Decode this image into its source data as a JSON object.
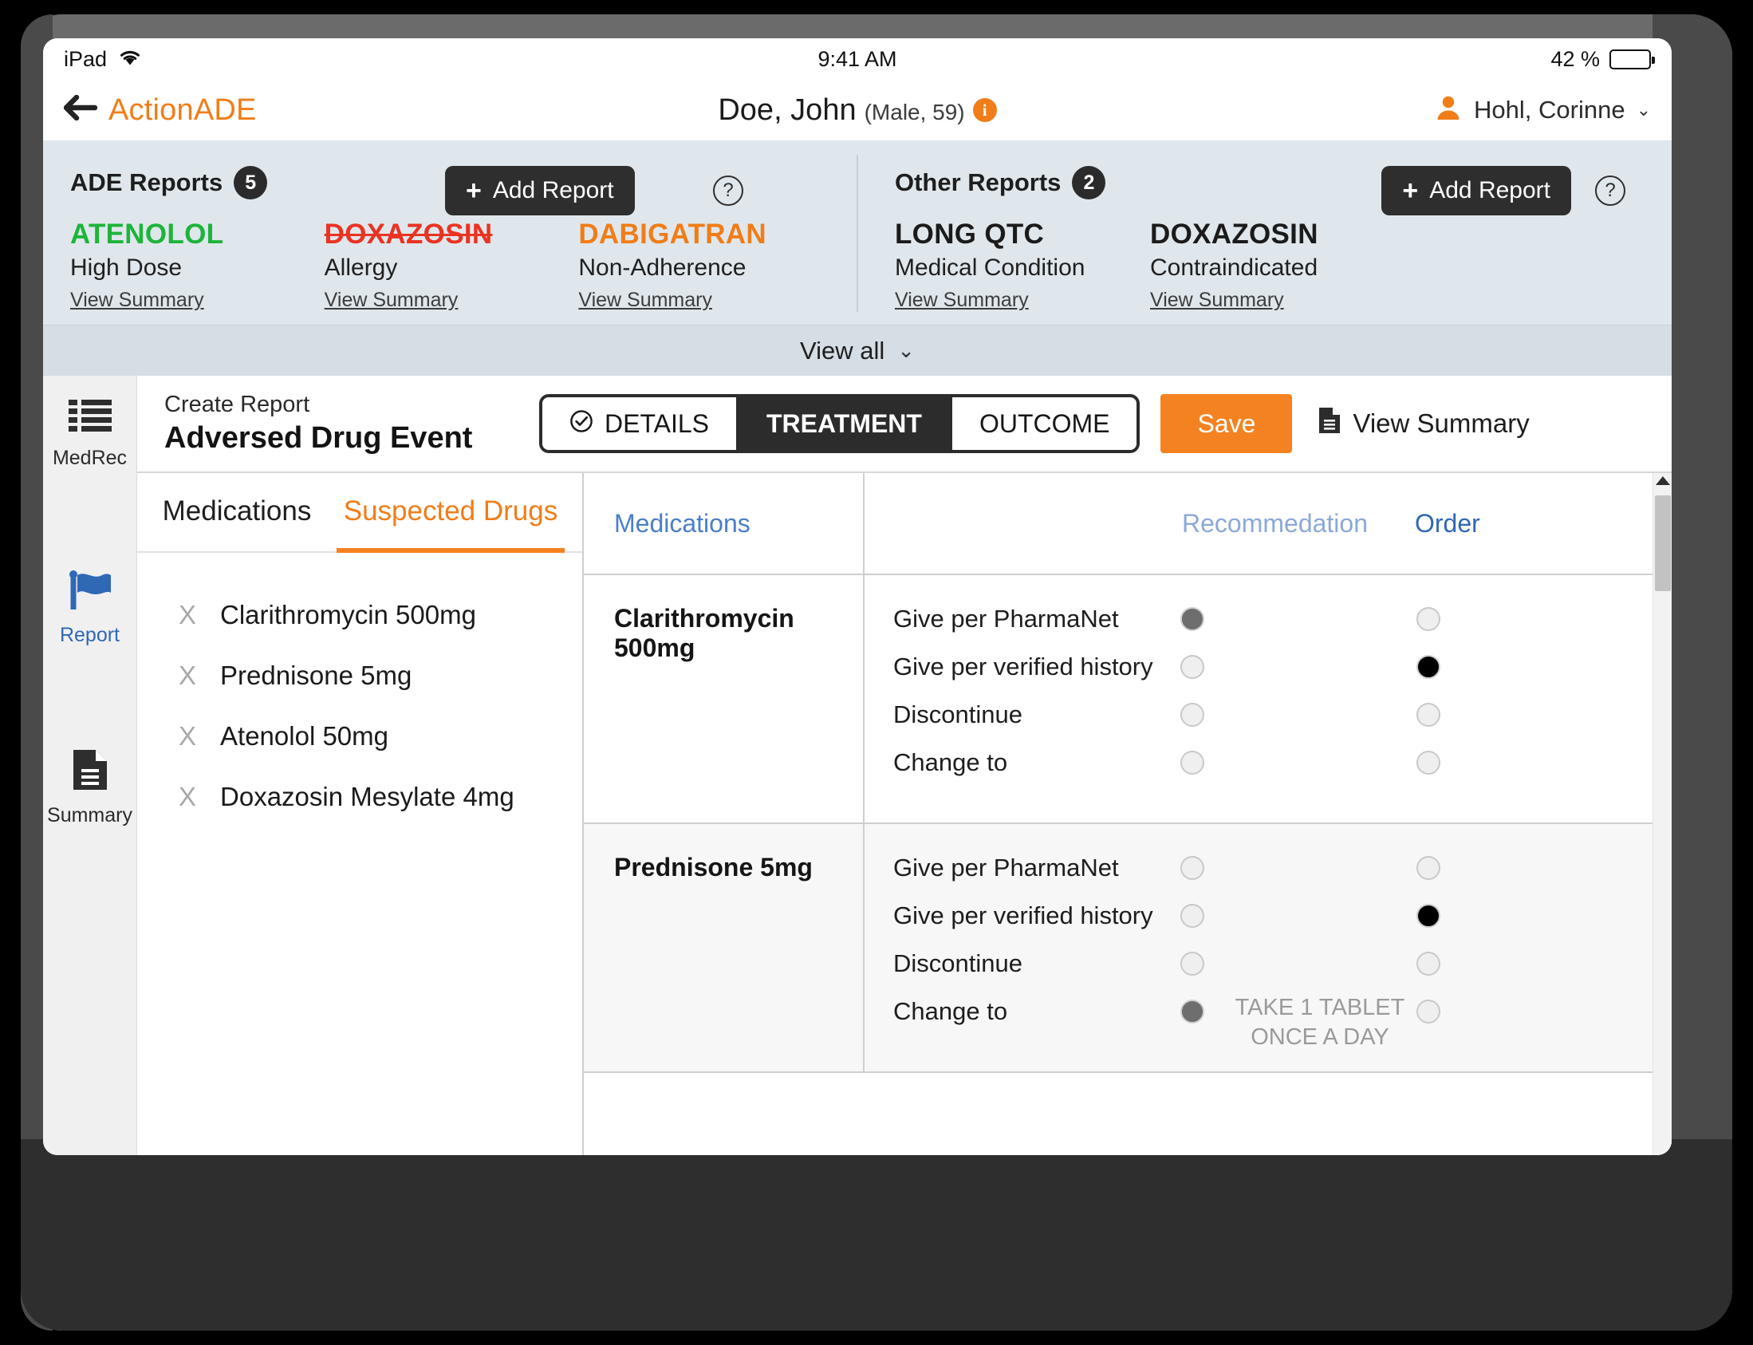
{
  "status_bar": {
    "device": "iPad",
    "wifi_icon": "wifi-icon",
    "time": "9:41 AM",
    "battery_percent": "42 %"
  },
  "nav": {
    "back_icon": "back-arrow-icon",
    "brand": "ActionADE",
    "patient_name": "Doe, John",
    "patient_meta": "(Male, 59)",
    "info_icon": "info-icon",
    "user_name": "Hohl, Corinne",
    "user_icon": "user-avatar-icon",
    "chevron": "⌄"
  },
  "reports": {
    "ade": {
      "title": "ADE Reports",
      "count": "5",
      "add_label": "Add Report",
      "help_glyph": "?",
      "items": [
        {
          "drug": "ATENOLOL",
          "reason": "High Dose",
          "link": "View Summary",
          "style": "green"
        },
        {
          "drug": "DOXAZOSIN",
          "reason": "Allergy",
          "link": "View Summary",
          "style": "red"
        },
        {
          "drug": "DABIGATRAN",
          "reason": "Non-Adherence",
          "link": "View Summary",
          "style": "orange"
        }
      ]
    },
    "other": {
      "title": "Other Reports",
      "count": "2",
      "add_label": "Add Report",
      "help_glyph": "?",
      "items": [
        {
          "drug": "LONG QTC",
          "reason": "Medical Condition",
          "link": "View Summary",
          "style": "dark"
        },
        {
          "drug": "DOXAZOSIN",
          "reason": "Contraindicated",
          "link": "View Summary",
          "style": "dark"
        }
      ]
    },
    "view_all": "View all",
    "view_all_chevron": "⌄"
  },
  "rail": {
    "items": [
      {
        "label": "MedRec",
        "icon": "list-icon",
        "active": false
      },
      {
        "label": "Report",
        "icon": "flag-icon",
        "active": true
      },
      {
        "label": "Summary",
        "icon": "document-icon",
        "active": false
      }
    ]
  },
  "toolbar": {
    "kicker": "Create Report",
    "title": "Adversed Drug Event",
    "segments": [
      {
        "label": "DETAILS",
        "icon": "check-circle-icon",
        "active": false
      },
      {
        "label": "TREATMENT",
        "icon": "",
        "active": true
      },
      {
        "label": "OUTCOME",
        "icon": "",
        "active": false
      }
    ],
    "save_label": "Save",
    "view_summary_label": "View Summary",
    "view_summary_icon": "document-icon"
  },
  "left_panel": {
    "tabs": [
      {
        "label": "Medications",
        "active": false
      },
      {
        "label": "Suspected Drugs",
        "active": true
      }
    ],
    "drugs": [
      {
        "remove_glyph": "X",
        "name": "Clarithromycin 500mg"
      },
      {
        "remove_glyph": "X",
        "name": "Prednisone 5mg"
      },
      {
        "remove_glyph": "X",
        "name": "Atenolol 50mg"
      },
      {
        "remove_glyph": "X",
        "name": "Doxazosin Mesylate 4mg"
      }
    ]
  },
  "treatment_table": {
    "headers": {
      "medications": "Medications",
      "recommendation": "Recommedation",
      "order": "Order"
    },
    "rows": [
      {
        "medication": "Clarithromycin 500mg",
        "shaded": false,
        "options": [
          {
            "label": "Give per PharmaNet",
            "rec": "grey",
            "ord": "empty",
            "extra": ""
          },
          {
            "label": "Give per verified history",
            "rec": "empty",
            "ord": "black",
            "extra": ""
          },
          {
            "label": "Discontinue",
            "rec": "empty",
            "ord": "empty",
            "extra": ""
          },
          {
            "label": "Change to",
            "rec": "empty",
            "ord": "empty",
            "extra": ""
          }
        ]
      },
      {
        "medication": "Prednisone 5mg",
        "shaded": true,
        "options": [
          {
            "label": "Give per PharmaNet",
            "rec": "empty",
            "ord": "empty",
            "extra": ""
          },
          {
            "label": "Give per verified history",
            "rec": "empty",
            "ord": "black",
            "extra": ""
          },
          {
            "label": "Discontinue",
            "rec": "empty",
            "ord": "empty",
            "extra": ""
          },
          {
            "label": "Change to",
            "rec": "grey",
            "ord": "empty",
            "extra": "TAKE 1 TABLET ONCE A DAY"
          }
        ]
      }
    ]
  },
  "colors": {
    "brand_orange": "#f07d18",
    "save_orange": "#f58220",
    "panel_blue": "#dfe7ec",
    "viewall_blue": "#d4dee4",
    "link_blue": "#2f68b5",
    "green": "#1db43a",
    "red": "#ea3323"
  }
}
